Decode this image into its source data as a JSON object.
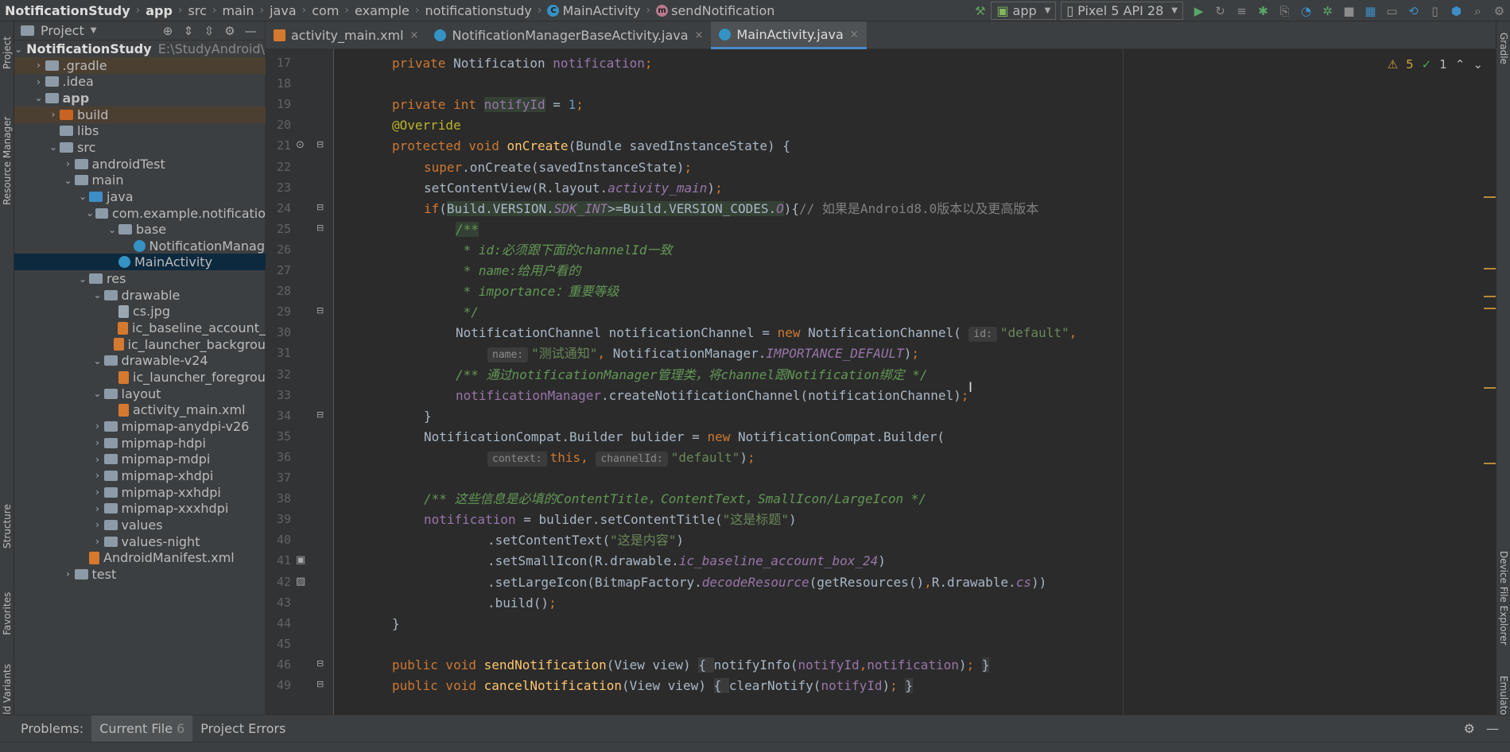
{
  "breadcrumb": {
    "items": [
      "NotificationStudy",
      "app",
      "src",
      "main",
      "java",
      "com",
      "example",
      "notificationstudy",
      "MainActivity",
      "sendNotification"
    ]
  },
  "toolbar": {
    "run_config": "app",
    "device": "Pixel 5 API 28"
  },
  "left_strip": {
    "tabs": [
      "Project",
      "Resource Manager",
      "Structure",
      "Favorites",
      "Build Variants"
    ]
  },
  "right_strip": {
    "tabs": [
      "Gradle",
      "Device File Explorer",
      "Emulator"
    ]
  },
  "project_panel": {
    "title": "Project",
    "root_path": "E:\\StudyAndroid\\No",
    "tree": [
      {
        "label": "NotificationStudy",
        "icon": "module-folder-icon",
        "depth": 0,
        "arrow": "down",
        "kind": "root"
      },
      {
        "label": ".gradle",
        "icon": "folder-icon",
        "depth": 1,
        "arrow": "right",
        "kind": "hl"
      },
      {
        "label": ".idea",
        "icon": "folder-icon",
        "depth": 1,
        "arrow": "right"
      },
      {
        "label": "app",
        "icon": "module-folder-icon",
        "depth": 1,
        "arrow": "down",
        "bold": true
      },
      {
        "label": "build",
        "icon": "folder-icon",
        "depth": 2,
        "arrow": "right",
        "kind": "hl",
        "orange": true
      },
      {
        "label": "libs",
        "icon": "folder-icon",
        "depth": 2,
        "arrow": ""
      },
      {
        "label": "src",
        "icon": "folder-icon",
        "depth": 2,
        "arrow": "down"
      },
      {
        "label": "androidTest",
        "icon": "folder-icon",
        "depth": 3,
        "arrow": "right"
      },
      {
        "label": "main",
        "icon": "folder-icon",
        "depth": 3,
        "arrow": "down"
      },
      {
        "label": "java",
        "icon": "folder-icon",
        "depth": 4,
        "arrow": "down",
        "blue": true
      },
      {
        "label": "com.example.notificatio",
        "icon": "package-icon",
        "depth": 5,
        "arrow": "down"
      },
      {
        "label": "base",
        "icon": "package-icon",
        "depth": 6,
        "arrow": "down"
      },
      {
        "label": "NotificationManag",
        "icon": "class-icon",
        "depth": 7,
        "arrow": ""
      },
      {
        "label": "MainActivity",
        "icon": "class-icon",
        "depth": 6,
        "arrow": "",
        "kind": "sel"
      },
      {
        "label": "res",
        "icon": "folder-icon",
        "depth": 4,
        "arrow": "down"
      },
      {
        "label": "drawable",
        "icon": "folder-icon",
        "depth": 5,
        "arrow": "down"
      },
      {
        "label": "cs.jpg",
        "icon": "file-icon",
        "depth": 6,
        "arrow": ""
      },
      {
        "label": "ic_baseline_account_",
        "icon": "xml-file-icon",
        "depth": 6,
        "arrow": ""
      },
      {
        "label": "ic_launcher_backgrou",
        "icon": "xml-file-icon",
        "depth": 6,
        "arrow": ""
      },
      {
        "label": "drawable-v24",
        "icon": "folder-icon",
        "depth": 5,
        "arrow": "down"
      },
      {
        "label": "ic_launcher_foregrou",
        "icon": "xml-file-icon",
        "depth": 6,
        "arrow": ""
      },
      {
        "label": "layout",
        "icon": "folder-icon",
        "depth": 5,
        "arrow": "down"
      },
      {
        "label": "activity_main.xml",
        "icon": "xml-file-icon",
        "depth": 6,
        "arrow": ""
      },
      {
        "label": "mipmap-anydpi-v26",
        "icon": "folder-icon",
        "depth": 5,
        "arrow": "right"
      },
      {
        "label": "mipmap-hdpi",
        "icon": "folder-icon",
        "depth": 5,
        "arrow": "right"
      },
      {
        "label": "mipmap-mdpi",
        "icon": "folder-icon",
        "depth": 5,
        "arrow": "right"
      },
      {
        "label": "mipmap-xhdpi",
        "icon": "folder-icon",
        "depth": 5,
        "arrow": "right"
      },
      {
        "label": "mipmap-xxhdpi",
        "icon": "folder-icon",
        "depth": 5,
        "arrow": "right"
      },
      {
        "label": "mipmap-xxxhdpi",
        "icon": "folder-icon",
        "depth": 5,
        "arrow": "right"
      },
      {
        "label": "values",
        "icon": "folder-icon",
        "depth": 5,
        "arrow": "right"
      },
      {
        "label": "values-night",
        "icon": "folder-icon",
        "depth": 5,
        "arrow": "right"
      },
      {
        "label": "AndroidManifest.xml",
        "icon": "manifest-icon",
        "depth": 4,
        "arrow": ""
      },
      {
        "label": "test",
        "icon": "folder-icon",
        "depth": 3,
        "arrow": "right"
      }
    ]
  },
  "editor_tabs": [
    {
      "label": "activity_main.xml",
      "icon": "xml-file-icon",
      "active": false
    },
    {
      "label": "NotificationManagerBaseActivity.java",
      "icon": "class-icon",
      "active": false
    },
    {
      "label": "MainActivity.java",
      "icon": "class-icon",
      "active": true
    }
  ],
  "inspections": {
    "warnings": "5",
    "weak_warnings": "1"
  },
  "line_numbers": [
    "17",
    "18",
    "19",
    "20",
    "21",
    "22",
    "23",
    "24",
    "25",
    "26",
    "27",
    "28",
    "29",
    "30",
    "31",
    "32",
    "33",
    "34",
    "35",
    "36",
    "37",
    "38",
    "39",
    "40",
    "41",
    "42",
    "43",
    "44",
    "45",
    "46",
    "49"
  ],
  "code_lines": [
    {
      "indent": 1,
      "tokens": [
        [
          "kw",
          "private "
        ],
        [
          "",
          "Notification "
        ],
        [
          "fld",
          "notification"
        ],
        [
          "kw",
          ";"
        ]
      ]
    },
    {
      "indent": 0,
      "tokens": []
    },
    {
      "indent": 1,
      "tokens": [
        [
          "kw",
          "private int "
        ],
        [
          "fld hl-bg",
          "notifyId"
        ],
        [
          "",
          " = "
        ],
        [
          "num",
          "1"
        ],
        [
          "kw",
          ";"
        ]
      ]
    },
    {
      "indent": 1,
      "tokens": [
        [
          "ann",
          "@Override"
        ]
      ]
    },
    {
      "indent": 1,
      "tokens": [
        [
          "kw",
          "protected void "
        ],
        [
          "fn",
          "onCreate"
        ],
        [
          "",
          "(Bundle savedInstanceState) {"
        ]
      ]
    },
    {
      "indent": 2,
      "tokens": [
        [
          "kw",
          "super"
        ],
        [
          "",
          ".onCreate(savedInstanceState)"
        ],
        [
          "kw",
          ";"
        ]
      ]
    },
    {
      "indent": 2,
      "tokens": [
        [
          "",
          "setContentView(R.layout."
        ],
        [
          "fldi",
          "activity_main"
        ],
        [
          "",
          ")"
        ],
        [
          "kw",
          ";"
        ]
      ]
    },
    {
      "indent": 2,
      "tokens": [
        [
          "kw",
          "if"
        ],
        [
          "",
          "("
        ],
        [
          "hl-bg",
          "Build.VERSION."
        ],
        [
          "fldi hl-bg",
          "SDK_INT"
        ],
        [
          "hl-bg",
          ">=Build.VERSION_CODES."
        ],
        [
          "fldi hl-bg",
          "O"
        ],
        [
          "",
          "){"
        ],
        [
          "cmt",
          "// 如果是Android8.0版本以及更高版本"
        ]
      ]
    },
    {
      "indent": 3,
      "tokens": [
        [
          "doc hl-bg",
          "/**"
        ]
      ]
    },
    {
      "indent": 3,
      "tokens": [
        [
          "doc",
          " * id:必须跟下面的channelId一致"
        ]
      ]
    },
    {
      "indent": 3,
      "tokens": [
        [
          "doc",
          " * name:给用户看的"
        ]
      ]
    },
    {
      "indent": 3,
      "tokens": [
        [
          "doc",
          " * importance：重要等级"
        ]
      ]
    },
    {
      "indent": 3,
      "tokens": [
        [
          "doc",
          " */"
        ]
      ]
    },
    {
      "indent": 3,
      "tokens": [
        [
          "",
          "NotificationChannel notificationChannel = "
        ],
        [
          "kw",
          "new "
        ],
        [
          "",
          "NotificationChannel( "
        ],
        [
          "hint",
          "id:"
        ],
        [
          "str",
          "\"default\""
        ],
        [
          "kw",
          ","
        ]
      ]
    },
    {
      "indent": 4,
      "tokens": [
        [
          "hint",
          "name:"
        ],
        [
          "str",
          "\"测试通知\""
        ],
        [
          "kw",
          ", "
        ],
        [
          "",
          "NotificationManager."
        ],
        [
          "fldi",
          "IMPORTANCE_DEFAULT"
        ],
        [
          "",
          ")"
        ],
        [
          "kw",
          ";"
        ]
      ]
    },
    {
      "indent": 3,
      "tokens": [
        [
          "doc",
          "/** 通过notificationManager管理类，将channel跟Notification绑定 */"
        ]
      ]
    },
    {
      "indent": 3,
      "tokens": [
        [
          "fld",
          "notificationManager"
        ],
        [
          "",
          ".createNotificationChannel(notificationChannel)"
        ],
        [
          "kw",
          ";"
        ]
      ]
    },
    {
      "indent": 2,
      "tokens": [
        [
          "",
          "}"
        ]
      ]
    },
    {
      "indent": 2,
      "tokens": [
        [
          "",
          "NotificationCompat.Builder "
        ],
        [
          "",
          "bulider"
        ],
        [
          "",
          " = "
        ],
        [
          "kw",
          "new "
        ],
        [
          "",
          "NotificationCompat.Builder("
        ]
      ]
    },
    {
      "indent": 4,
      "tokens": [
        [
          "hint",
          "context:"
        ],
        [
          "kw",
          "this, "
        ],
        [
          "hint",
          "channelId:"
        ],
        [
          "str",
          "\"default\""
        ],
        [
          "",
          ")"
        ],
        [
          "kw",
          ";"
        ]
      ]
    },
    {
      "indent": 0,
      "tokens": []
    },
    {
      "indent": 2,
      "tokens": [
        [
          "doc",
          "/** 这些信息是必填的ContentTitle，ContentText，SmallIcon/LargeIcon */"
        ]
      ]
    },
    {
      "indent": 2,
      "tokens": [
        [
          "fld",
          "notification"
        ],
        [
          "",
          " = bulider.setContentTitle("
        ],
        [
          "str",
          "\"这是标题\""
        ],
        [
          "",
          ")"
        ]
      ]
    },
    {
      "indent": 4,
      "tokens": [
        [
          "",
          ".setContentText("
        ],
        [
          "str",
          "\"这是内容\""
        ],
        [
          "",
          ")"
        ]
      ]
    },
    {
      "indent": 4,
      "tokens": [
        [
          "",
          ".setSmallIcon(R.drawable."
        ],
        [
          "fldi",
          "ic_baseline_account_box_24"
        ],
        [
          "",
          ")"
        ]
      ]
    },
    {
      "indent": 4,
      "tokens": [
        [
          "",
          ".setLargeIcon(BitmapFactory."
        ],
        [
          "fldi",
          "decodeResource"
        ],
        [
          "",
          "(getResources()"
        ],
        [
          "kw",
          ","
        ],
        [
          "",
          "R.drawable."
        ],
        [
          "fldi",
          "cs"
        ],
        [
          "",
          "))"
        ]
      ]
    },
    {
      "indent": 4,
      "tokens": [
        [
          "",
          ".build()"
        ],
        [
          "kw",
          ";"
        ]
      ]
    },
    {
      "indent": 1,
      "tokens": [
        [
          "",
          "}"
        ]
      ]
    },
    {
      "indent": 0,
      "tokens": []
    },
    {
      "indent": 1,
      "tokens": [
        [
          "kw",
          "public void "
        ],
        [
          "fn",
          "sendNotification"
        ],
        [
          "",
          "(View view) "
        ],
        [
          "fold",
          "{ "
        ],
        [
          "",
          "notifyInfo("
        ],
        [
          "fld",
          "notifyId"
        ],
        [
          "kw",
          ","
        ],
        [
          "fld",
          "notification"
        ],
        [
          "",
          ")"
        ],
        [
          "kw",
          "; "
        ],
        [
          "fold",
          "}"
        ]
      ]
    },
    {
      "indent": 1,
      "tokens": [
        [
          "kw",
          "public void "
        ],
        [
          "fn",
          "cancelNotification"
        ],
        [
          "",
          "(View view) "
        ],
        [
          "fold",
          "{ "
        ],
        [
          "",
          "clearNotify("
        ],
        [
          "fld",
          "notifyId"
        ],
        [
          "",
          ")"
        ],
        [
          "kw",
          "; "
        ],
        [
          "fold",
          "}"
        ]
      ]
    }
  ],
  "bottom_bar": {
    "problems_label": "Problems:",
    "tabs": [
      {
        "label": "Current File",
        "count": "6",
        "active": true
      },
      {
        "label": "Project Errors",
        "count": "",
        "active": false
      }
    ]
  }
}
